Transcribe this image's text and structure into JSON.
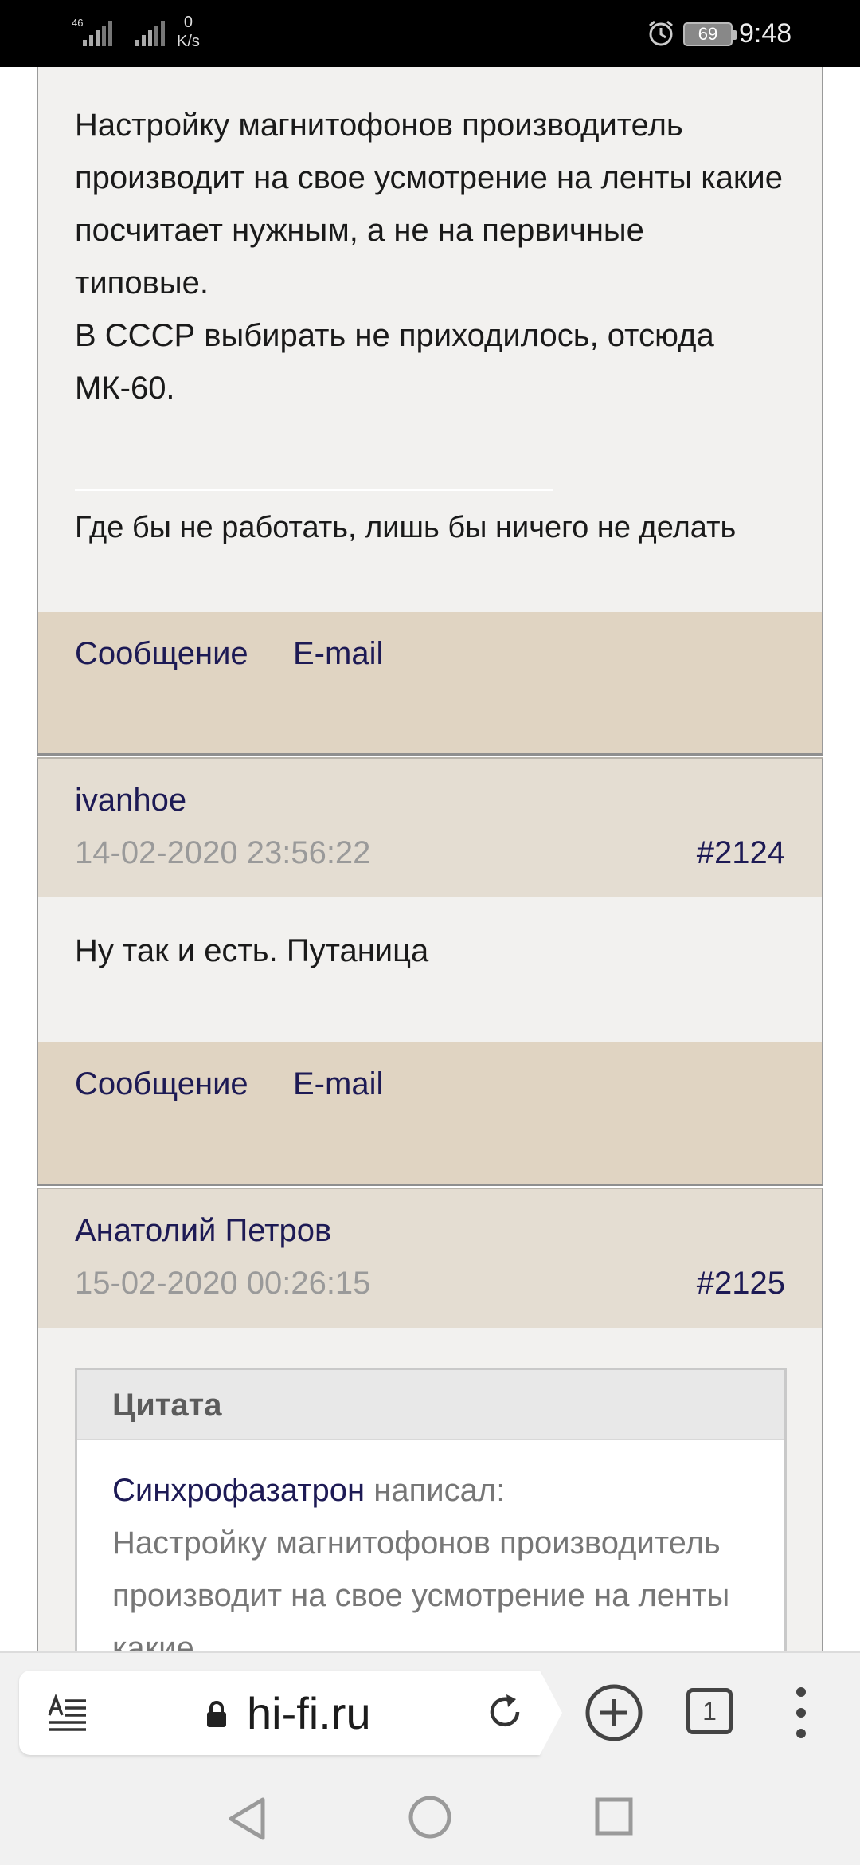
{
  "status_bar": {
    "network_label": "46",
    "speed_value": "0",
    "speed_unit": "K/s",
    "battery": "69",
    "time": "9:48"
  },
  "posts": [
    {
      "text": "Настройку магнитофонов производитель производит на свое усмотрение на ленты какие посчитает нужным, а не на первичные типовые.\nВ СССР выбирать не приходилось, отсюда  МК-60.",
      "signature": "Где бы не работать, лишь бы ничего не делать",
      "message_link": "Сообщение",
      "email_link": "E-mail"
    },
    {
      "author": "ivanhoe",
      "date": "14-02-2020 23:56:22",
      "number": "#2124",
      "text": "Ну так и есть. Путаница",
      "message_link": "Сообщение",
      "email_link": "E-mail"
    },
    {
      "author": "Анатолий Петров",
      "date": "15-02-2020 00:26:15",
      "number": "#2125",
      "quote": {
        "title": "Цитата",
        "author": "Синхрофазатрон",
        "wrote": "написал:",
        "text": "Настройку магнитофонов производитель производит на свое усмотрение на ленты какие"
      }
    }
  ],
  "browser": {
    "url": "hi-fi.ru",
    "tab_count": "1",
    "reader_icon": "reader-mode-icon",
    "lock_icon": "lock-icon",
    "reload_icon": "reload-icon",
    "new_tab_icon": "plus-circle-icon",
    "menu_icon": "more-vertical-icon"
  },
  "system_nav": {
    "back_icon": "back-triangle-icon",
    "home_icon": "home-circle-icon",
    "recents_icon": "recents-square-icon"
  }
}
